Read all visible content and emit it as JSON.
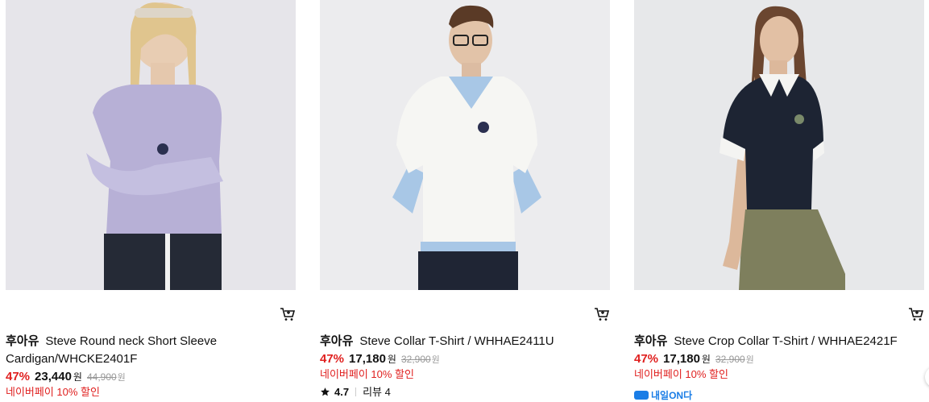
{
  "products": [
    {
      "brand": "후아유",
      "name": "Steve Round neck Short Sleeve Cardigan/WHCKE2401F",
      "discount": "47%",
      "price": "23,440",
      "currency": "원",
      "original_price": "44,900",
      "original_currency": "원",
      "pay_benefit": "네이버페이 10% 할인"
    },
    {
      "brand": "후아유",
      "name": "Steve Collar T-Shirt / WHHAE2411U",
      "discount": "47%",
      "price": "17,180",
      "currency": "원",
      "original_price": "32,900",
      "original_currency": "원",
      "pay_benefit": "네이버페이 10% 할인",
      "rating": "4.7",
      "review_label": "리뷰 4"
    },
    {
      "brand": "후아유",
      "name": "Steve Crop Collar T-Shirt / WHHAE2421F",
      "discount": "47%",
      "price": "17,180",
      "currency": "원",
      "original_price": "32,900",
      "original_currency": "원",
      "pay_benefit": "네이버페이 10% 할인",
      "delivery_badge": "내일ON다"
    }
  ],
  "icons": {
    "cart": "cart-icon",
    "star": "star-icon",
    "delivery": "delivery-truck-icon"
  },
  "colors": {
    "discount": "#e0201f",
    "delivery": "#1a7de6",
    "strike": "#999999"
  }
}
